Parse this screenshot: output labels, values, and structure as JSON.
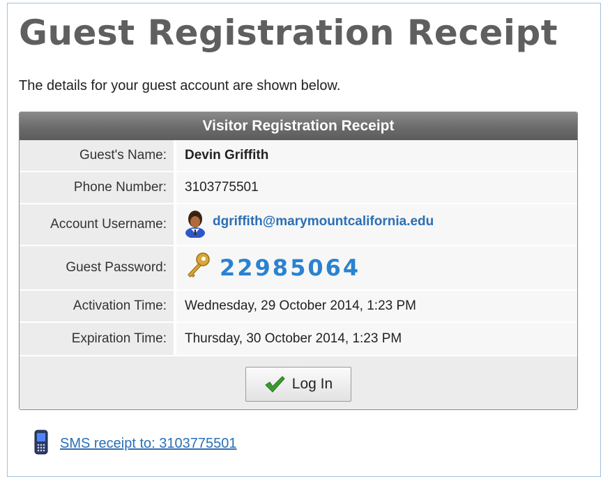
{
  "page": {
    "title": "Guest Registration Receipt",
    "intro": "The details for your guest account are shown below."
  },
  "receipt": {
    "header": "Visitor Registration Receipt",
    "rows": [
      {
        "label": "Guest's Name:",
        "value": "Devin Griffith"
      },
      {
        "label": "Phone Number:",
        "value": "3103775501"
      },
      {
        "label": "Account Username:",
        "value": "dgriffith@marymountcalifornia.edu",
        "icon": "user-avatar-icon"
      },
      {
        "label": "Guest Password:",
        "value": "22985064",
        "icon": "key-icon"
      },
      {
        "label": "Activation Time:",
        "value": "Wednesday, 29 October 2014, 1:23 PM"
      },
      {
        "label": "Expiration Time:",
        "value": "Thursday, 30 October 2014, 1:23 PM"
      }
    ],
    "login_button": {
      "label": "Log In",
      "icon": "checkmark-icon"
    }
  },
  "sms": {
    "link_text": "SMS receipt to: 3103775501",
    "icon": "mobile-phone-icon"
  },
  "colors": {
    "title": "#5f5f5f",
    "header_bg": "#6b6b6b",
    "label_bg": "#ececec",
    "value_bg": "#f7f7f7",
    "link": "#2a6fb5",
    "password": "#2a82d0",
    "check": "#3c9a2e",
    "frame_border": "#9ec0df"
  }
}
